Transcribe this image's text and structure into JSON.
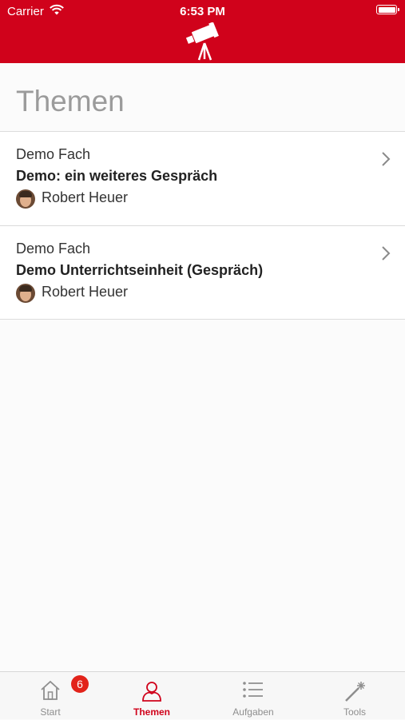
{
  "status_bar": {
    "carrier": "Carrier",
    "time": "6:53 PM"
  },
  "header": {
    "logo_icon": "telescope-icon",
    "color": "#d0021b"
  },
  "page": {
    "title": "Themen"
  },
  "topics": [
    {
      "subject": "Demo Fach",
      "title": "Demo: ein weiteres Gespräch",
      "teacher": "Robert Heuer"
    },
    {
      "subject": "Demo Fach",
      "title": "Demo Unterrichtseinheit (Gespräch)",
      "teacher": "Robert Heuer"
    }
  ],
  "tabbar": {
    "active_color": "#d0021b",
    "tabs": [
      {
        "label": "Start",
        "icon": "home-icon",
        "badge": "6"
      },
      {
        "label": "Themen",
        "icon": "person-icon",
        "active": true
      },
      {
        "label": "Aufgaben",
        "icon": "list-icon"
      },
      {
        "label": "Tools",
        "icon": "magic-wand-icon"
      }
    ]
  }
}
